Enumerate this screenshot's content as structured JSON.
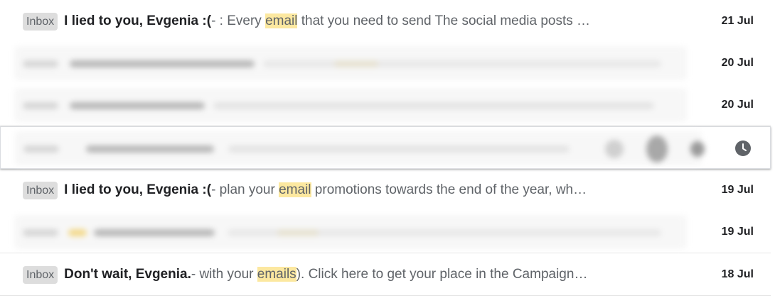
{
  "rows": [
    {
      "label": "Inbox",
      "subject": "I lied to you, Evgenia :(",
      "snippet_pre": " - : Every ",
      "highlight": "email",
      "snippet_post": " that you need to send The social media posts …",
      "date": "21 Jul"
    },
    {
      "date": "20 Jul"
    },
    {
      "date": "20 Jul"
    },
    {
      "hover_icon": "clock-icon"
    },
    {
      "label": "Inbox",
      "subject": "I lied to you, Evgenia :(",
      "snippet_pre": " - plan your ",
      "highlight": "email",
      "snippet_post": " promotions towards the end of the year, wh…",
      "date": "19 Jul"
    },
    {
      "date": "19 Jul"
    },
    {
      "label": "Inbox",
      "subject": "Don't wait, Evgenia.",
      "snippet_pre": " - with your ",
      "highlight": "emails",
      "snippet_post": "). Click here to get your place in the Campaign…",
      "date": "18 Jul"
    }
  ],
  "colors": {
    "highlight": "#fce8a0",
    "label_bg": "#dddddd",
    "icon": "#5f6368"
  }
}
